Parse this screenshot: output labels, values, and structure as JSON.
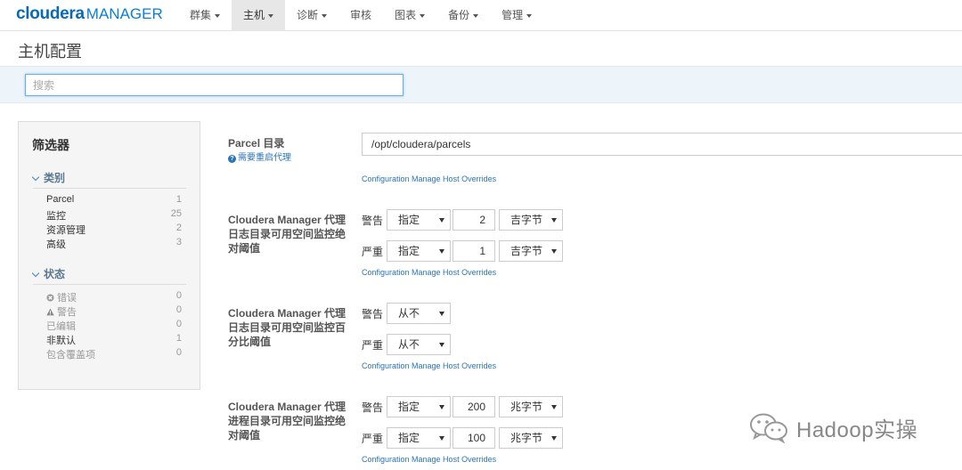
{
  "nav": {
    "logo_brand": "cloudera",
    "logo_product": "MANAGER",
    "items": [
      {
        "label": "群集",
        "dropdown": true
      },
      {
        "label": "主机",
        "dropdown": true,
        "active": true
      },
      {
        "label": "诊断",
        "dropdown": true
      },
      {
        "label": "审核",
        "dropdown": false
      },
      {
        "label": "图表",
        "dropdown": true
      },
      {
        "label": "备份",
        "dropdown": true
      },
      {
        "label": "管理",
        "dropdown": true
      }
    ]
  },
  "page": {
    "title": "主机配置"
  },
  "search": {
    "placeholder": "搜索",
    "value": ""
  },
  "filter": {
    "title": "筛选器",
    "category_header": "类别",
    "categories": [
      {
        "label": "Parcel",
        "count": "1"
      },
      {
        "label": "监控",
        "count": "25"
      },
      {
        "label": "资源管理",
        "count": "2"
      },
      {
        "label": "高级",
        "count": "3"
      }
    ],
    "status_header": "状态",
    "statuses": [
      {
        "label": "错误",
        "count": "0",
        "icon": "error-icon"
      },
      {
        "label": "警告",
        "count": "0",
        "icon": "warning-icon"
      },
      {
        "label": "已编辑",
        "count": "0"
      },
      {
        "label": "非默认",
        "count": "1"
      },
      {
        "label": "包含覆盖项",
        "count": "0"
      }
    ]
  },
  "configs": {
    "parcel": {
      "label": "Parcel 目录",
      "restart_note": "需要重启代理",
      "value": "/opt/cloudera/parcels",
      "overrides_link": "Configuration Manage Host Overrides"
    },
    "log_abs": {
      "label": "Cloudera Manager 代理日志目录可用空间监控绝对阈值",
      "warning_label": "警告",
      "warning_mode": "指定",
      "warning_value": "2",
      "warning_unit": "吉字节",
      "critical_label": "严重",
      "critical_mode": "指定",
      "critical_value": "1",
      "critical_unit": "吉字节",
      "overrides_link": "Configuration Manage Host Overrides"
    },
    "log_pct": {
      "label": "Cloudera Manager 代理日志目录可用空间监控百分比阈值",
      "warning_label": "警告",
      "warning_mode": "从不",
      "critical_label": "严重",
      "critical_mode": "从不",
      "overrides_link": "Configuration Manage Host Overrides"
    },
    "proc_abs": {
      "label": "Cloudera Manager 代理进程目录可用空间监控绝对阈值",
      "warning_label": "警告",
      "warning_mode": "指定",
      "warning_value": "200",
      "warning_unit": "兆字节",
      "critical_label": "严重",
      "critical_mode": "指定",
      "critical_value": "100",
      "critical_unit": "兆字节",
      "overrides_link": "Configuration Manage Host Overrides"
    }
  },
  "watermark": {
    "text": "Hadoop实操"
  }
}
